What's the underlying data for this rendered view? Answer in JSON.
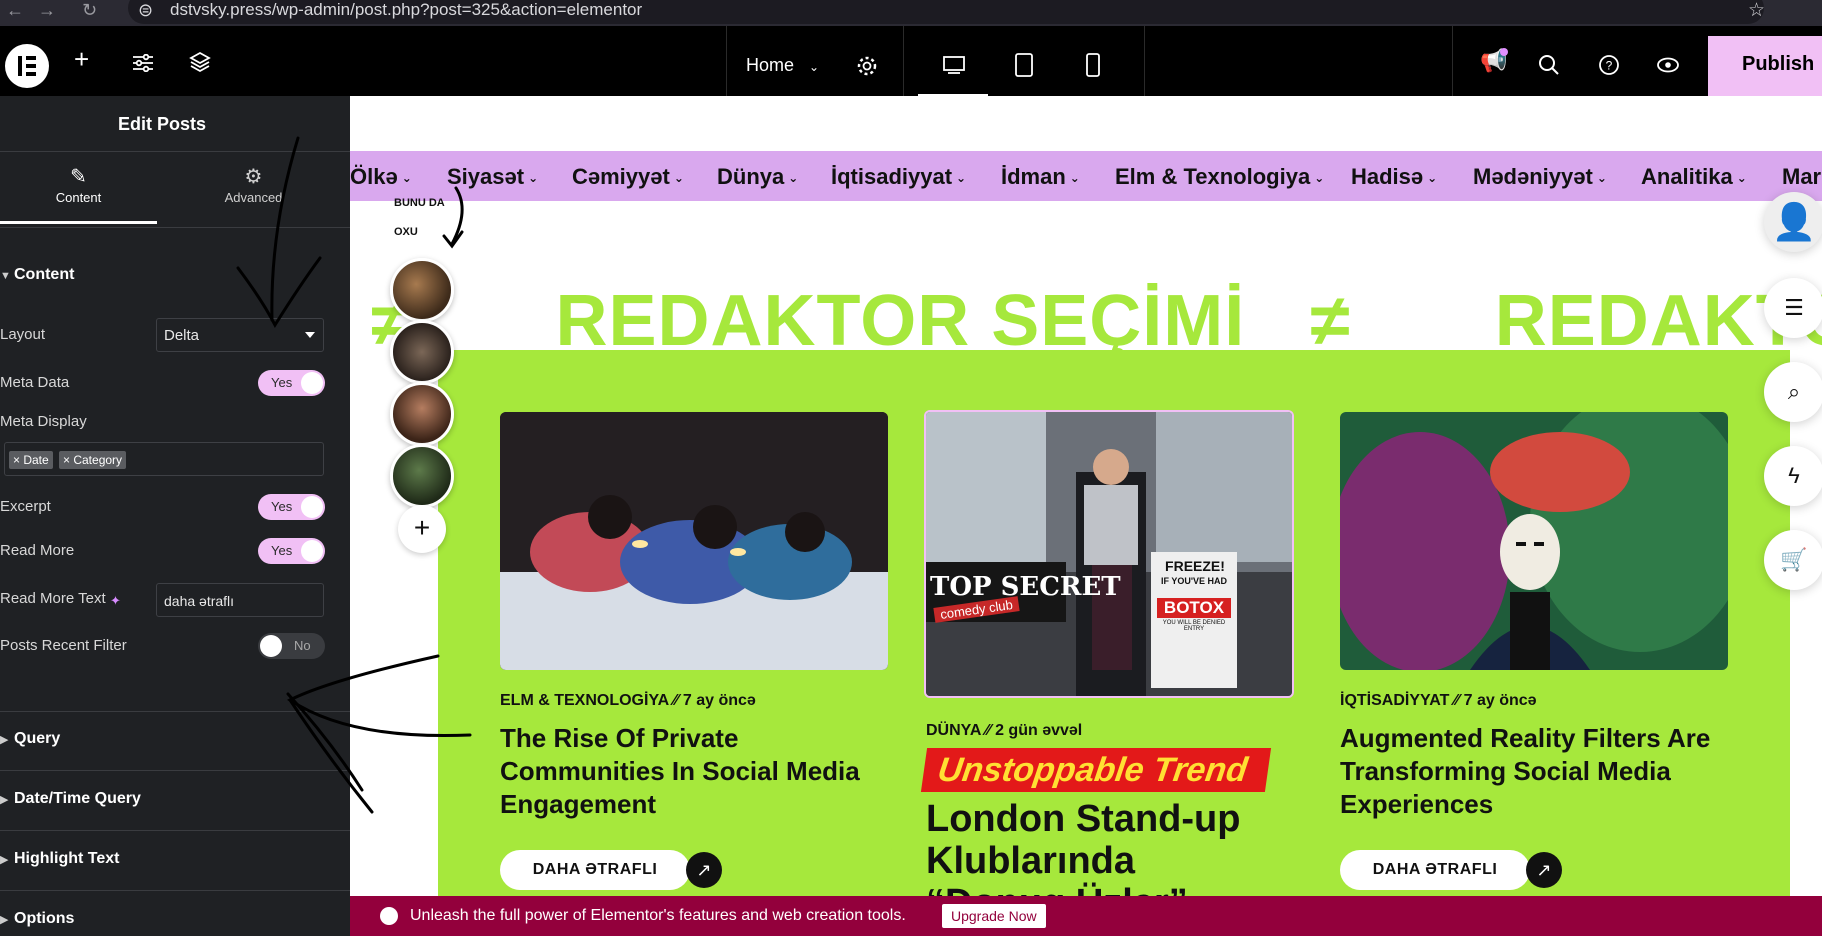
{
  "browser": {
    "url": "dstvsky.press/wp-admin/post.php?post=325&action=elementor"
  },
  "topbar": {
    "page_name": "Home",
    "publish_label": "Publish"
  },
  "panel": {
    "title": "Edit Posts",
    "tabs": [
      {
        "label": "Content",
        "icon": "pencil-icon"
      },
      {
        "label": "Advanced",
        "icon": "gear-icon"
      }
    ],
    "section_content": "Content",
    "layout_label": "Layout",
    "layout_value": "Delta",
    "meta_data_label": "Meta Data",
    "meta_data_value": "Yes",
    "meta_display_label": "Meta Display",
    "meta_tags": [
      "Date",
      "Category"
    ],
    "excerpt_label": "Excerpt",
    "excerpt_value": "Yes",
    "read_more_label": "Read More",
    "read_more_value": "Yes",
    "read_more_text_label": "Read More Text",
    "read_more_text_value": "daha ətraflı",
    "recent_filter_label": "Posts Recent Filter",
    "recent_filter_value": "No",
    "sections": [
      "Query",
      "Date/Time Query",
      "Highlight Text",
      "Options"
    ]
  },
  "menu": [
    "Ölkə",
    "Siyasət",
    "Cəmiyyət",
    "Dünya",
    "İqtisadiyyat",
    "İdman",
    "Elm & Texnologiya",
    "Hadisə",
    "Mədəniyyət",
    "Analitika",
    "Mar"
  ],
  "stories_label": "BUNU DA OXU",
  "marquee": [
    "REDAKTOR SEÇİMİ",
    "REDAKTOR"
  ],
  "cards": [
    {
      "category": "ELM & TEXNOLOGİYA",
      "time": "7 ay öncə",
      "title": "The Rise Of Private Communities In Social Media Engagement",
      "button": "DAHA ƏTRAFLI"
    },
    {
      "category": "DÜNYA",
      "time": "2 gün əvvəl",
      "badge": "Unstoppable Trend",
      "title": "London Stand-up Klublarında “Donuq Üzlər” Qadağası",
      "sign_top": "TOP SECRET",
      "sign_sub": "comedy club",
      "poster_top": "FREEZE!",
      "poster_mid": "IF YOU'VE HAD",
      "poster_main": "BOTOX",
      "poster_sub": "YOU WILL BE DENIED ENTRY"
    },
    {
      "category": "İQTİSADİYYAT",
      "time": "7 ay öncə",
      "title": "Augmented Reality Filters Are Transforming Social Media Experiences",
      "button": "DAHA ƏTRAFLI"
    }
  ],
  "promo": {
    "message": "Unleash the full power of Elementor's features and web creation tools.",
    "button": "Upgrade Now"
  },
  "colors": {
    "accent_pink": "#f1c0f5",
    "menu_bar": "#d9a8ee",
    "lime": "#a6e83c",
    "promo": "#93003c",
    "badge_red": "#e31919"
  }
}
